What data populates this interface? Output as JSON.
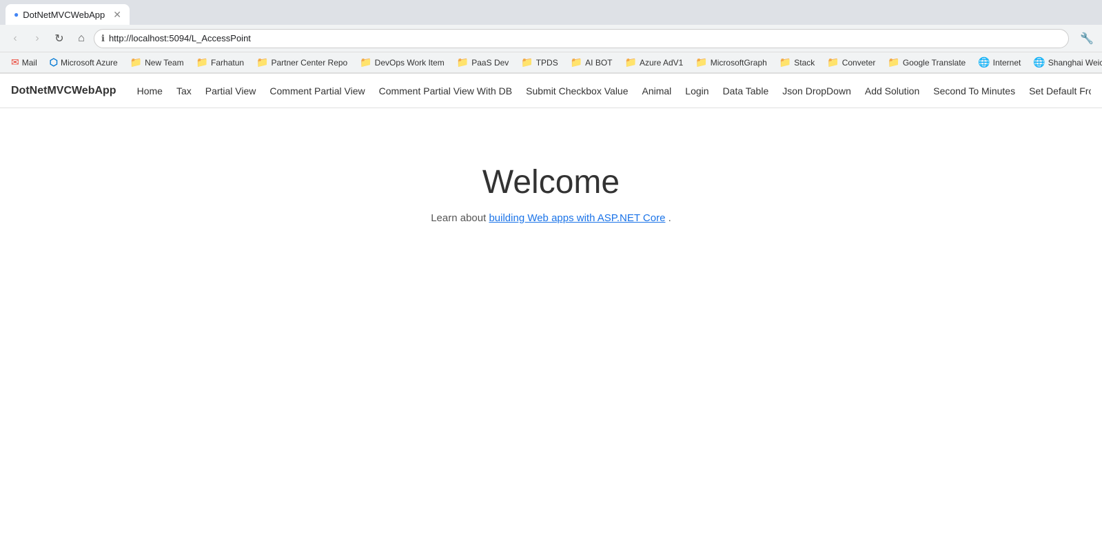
{
  "browser": {
    "tab": {
      "title": "DotNetMVCWebApp",
      "url": "http://localhost:5094/L_AccessPoint"
    },
    "nav_buttons": {
      "back": "‹",
      "forward": "›",
      "reload": "↺",
      "home": "⌂"
    }
  },
  "bookmarks": [
    {
      "label": "Mail",
      "icon": "mail"
    },
    {
      "label": "Microsoft Azure",
      "icon": "azure"
    },
    {
      "label": "New Team",
      "icon": "folder"
    },
    {
      "label": "Farhatun",
      "icon": "folder"
    },
    {
      "label": "Partner Center Repo",
      "icon": "folder"
    },
    {
      "label": "DevOps Work Item",
      "icon": "folder"
    },
    {
      "label": "PaaS Dev",
      "icon": "folder"
    },
    {
      "label": "TPDS",
      "icon": "folder"
    },
    {
      "label": "AI BOT",
      "icon": "folder"
    },
    {
      "label": "Azure AdV1",
      "icon": "folder"
    },
    {
      "label": "MicrosoftGraph",
      "icon": "folder"
    },
    {
      "label": "Stack",
      "icon": "folder"
    },
    {
      "label": "Conveter",
      "icon": "folder"
    },
    {
      "label": "Google Translate",
      "icon": "folder"
    },
    {
      "label": "Internet",
      "icon": "globe"
    },
    {
      "label": "Shanghai Weich",
      "icon": "globe"
    }
  ],
  "app": {
    "brand": "DotNetMVCWebApp",
    "nav_links": [
      "Home",
      "Tax",
      "Partial View",
      "Comment Partial View",
      "Comment Partial View With DB",
      "Submit Checkbox Value",
      "Animal",
      "Login",
      "Data Table",
      "Json DropDown",
      "Add Solution",
      "Second To Minutes",
      "Set Default From Enum"
    ]
  },
  "content": {
    "welcome_title": "Welcome",
    "welcome_text_prefix": "Learn about ",
    "welcome_link_text": "building Web apps with ASP.NET Core",
    "welcome_text_suffix": "."
  },
  "extensions": {
    "icon": "🔧"
  }
}
